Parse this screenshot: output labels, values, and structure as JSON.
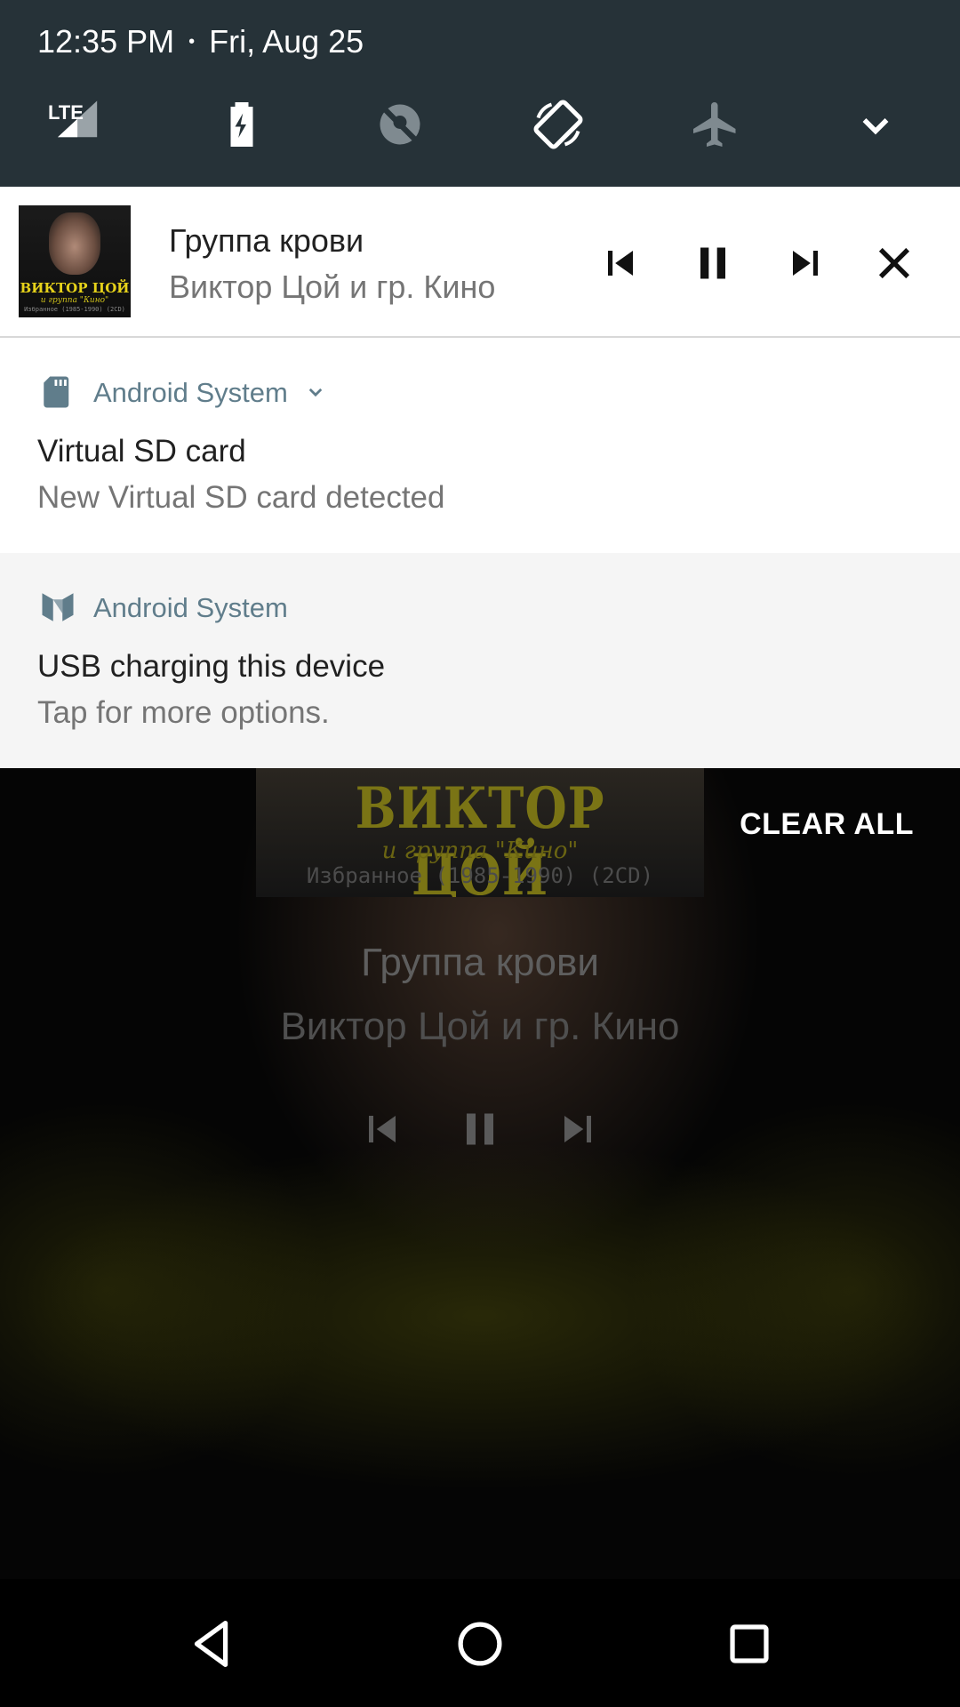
{
  "status_bar": {
    "time": "12:35 PM",
    "separator": "•",
    "date": "Fri, Aug 25"
  },
  "quick_settings": [
    {
      "name": "lte-signal-icon",
      "label": "LTE"
    },
    {
      "name": "battery-charging-icon"
    },
    {
      "name": "location-off-icon"
    },
    {
      "name": "auto-rotate-icon"
    },
    {
      "name": "airplane-mode-icon"
    },
    {
      "name": "expand-chevron-icon"
    }
  ],
  "media_notification": {
    "title": "Группа крови",
    "artist": "Виктор Цой и гр. Кино",
    "album_art": {
      "line1": "ВИКТОР ЦОЙ",
      "line2": "и группа \"Кино\"",
      "line3": "Избранное (1985-1990) (2CD)"
    },
    "controls": [
      "previous",
      "pause",
      "next",
      "close"
    ]
  },
  "notifications": [
    {
      "app_name": "Android System",
      "icon": "sd-card-icon",
      "title": "Virtual SD card",
      "text": "New Virtual SD card detected",
      "expandable": true
    },
    {
      "app_name": "Android System",
      "icon": "android-n-icon",
      "title": "USB charging this device",
      "text": "Tap for more options."
    }
  ],
  "clear_all_label": "CLEAR ALL",
  "background_player": {
    "cover_title": "ВИКТОР ЦОЙ",
    "cover_subtitle": "и группа \"Кино\"",
    "cover_footer": "Избранное (1985-1990) (2CD)",
    "title": "Группа крови",
    "artist": "Виктор Цой и гр. Кино"
  },
  "colors": {
    "shade_header": "#263238",
    "app_name": "#607d8b",
    "ongoing_notification_bg": "#f5f5f5"
  }
}
